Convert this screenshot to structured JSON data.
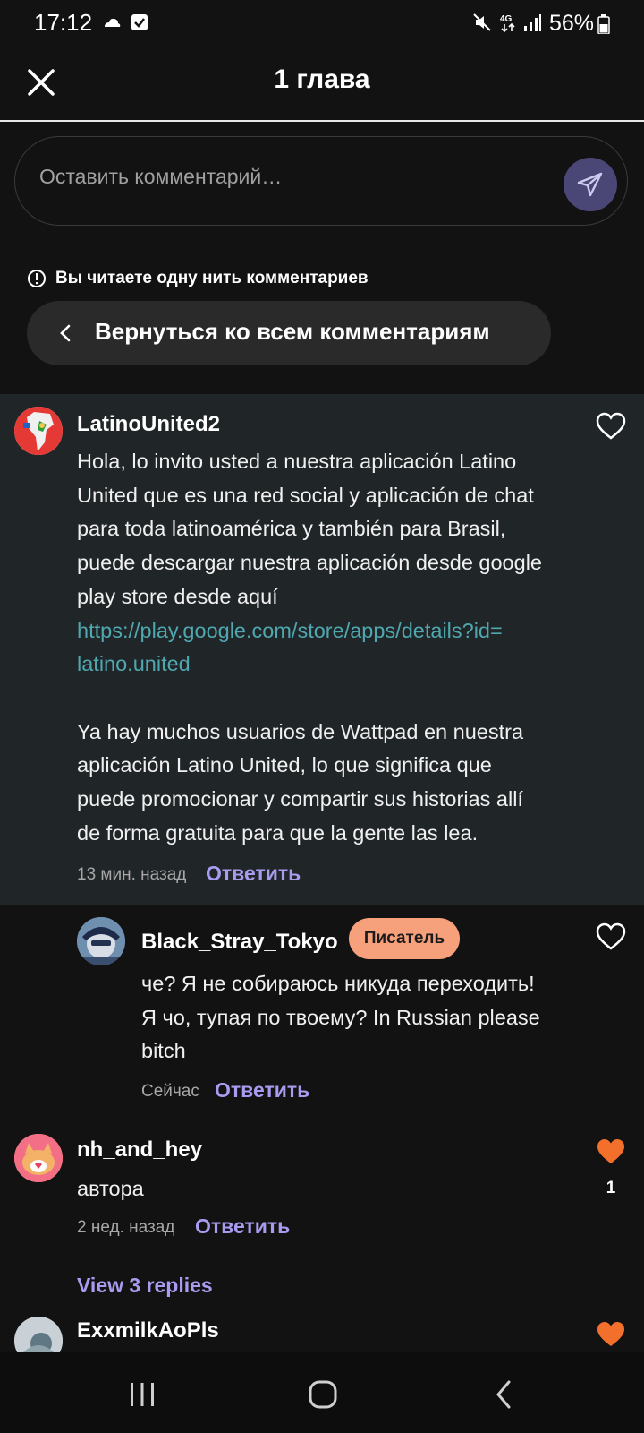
{
  "status_bar": {
    "time": "17:12",
    "battery": "56%",
    "icons": [
      "weather-icon",
      "check-box-icon",
      "mute-icon",
      "4g-icon",
      "signal-icon",
      "battery-icon"
    ]
  },
  "header": {
    "title": "1 глава",
    "close_icon": "close-icon"
  },
  "composer": {
    "placeholder": "Оставить комментарий…",
    "send_icon": "send-icon"
  },
  "thread": {
    "notice": "Вы читаете одну нить комментариев",
    "back_label": "Вернуться ко всем комментариям"
  },
  "comments": [
    {
      "username": "LatinoUnited2",
      "lines": [
        "Hola, lo invito usted a nuestra aplicación Latino",
        "United que es una red social y aplicación de chat",
        "para toda latinoamérica y también para Brasil,",
        "puede descargar nuestra aplicación desde google",
        "play store desde aquí"
      ],
      "link_lines": [
        "https://play.google.com/store/apps/details?id=",
        "latino.united"
      ],
      "lines2": [
        "Ya hay muchos usuarios de Wattpad en nuestra",
        "aplicación Latino United, lo que significa que",
        "puede promocionar y compartir sus historias allí",
        "de forma gratuita para que la gente las lea."
      ],
      "time": "13 мин. назад",
      "reply": "Ответить",
      "liked": false
    },
    {
      "username": "Black_Stray_Tokyo",
      "badge": "Писатель",
      "lines": [
        "че? Я не собираюсь никуда переходить!",
        "Я чо, тупая по твоему? In Russian please",
        "bitch"
      ],
      "time": "Сейчас",
      "reply": "Ответить",
      "liked": false
    },
    {
      "username": "nh_and_hey",
      "lines": [
        "автора"
      ],
      "time": "2 нед. назад",
      "reply": "Ответить",
      "liked": true,
      "likes": "1",
      "view_replies": "View 3 replies"
    },
    {
      "username": "ExxmilkAoPls",
      "liked": true
    }
  ],
  "colors": {
    "background": "#121212",
    "highlight": "#202628",
    "accent": "#a99cf0",
    "heart": "#f36f2c",
    "badge": "#f7a07c",
    "link": "#4fa7b0"
  },
  "nav": {
    "icons": [
      "recent-apps-icon",
      "home-icon",
      "back-icon"
    ]
  }
}
